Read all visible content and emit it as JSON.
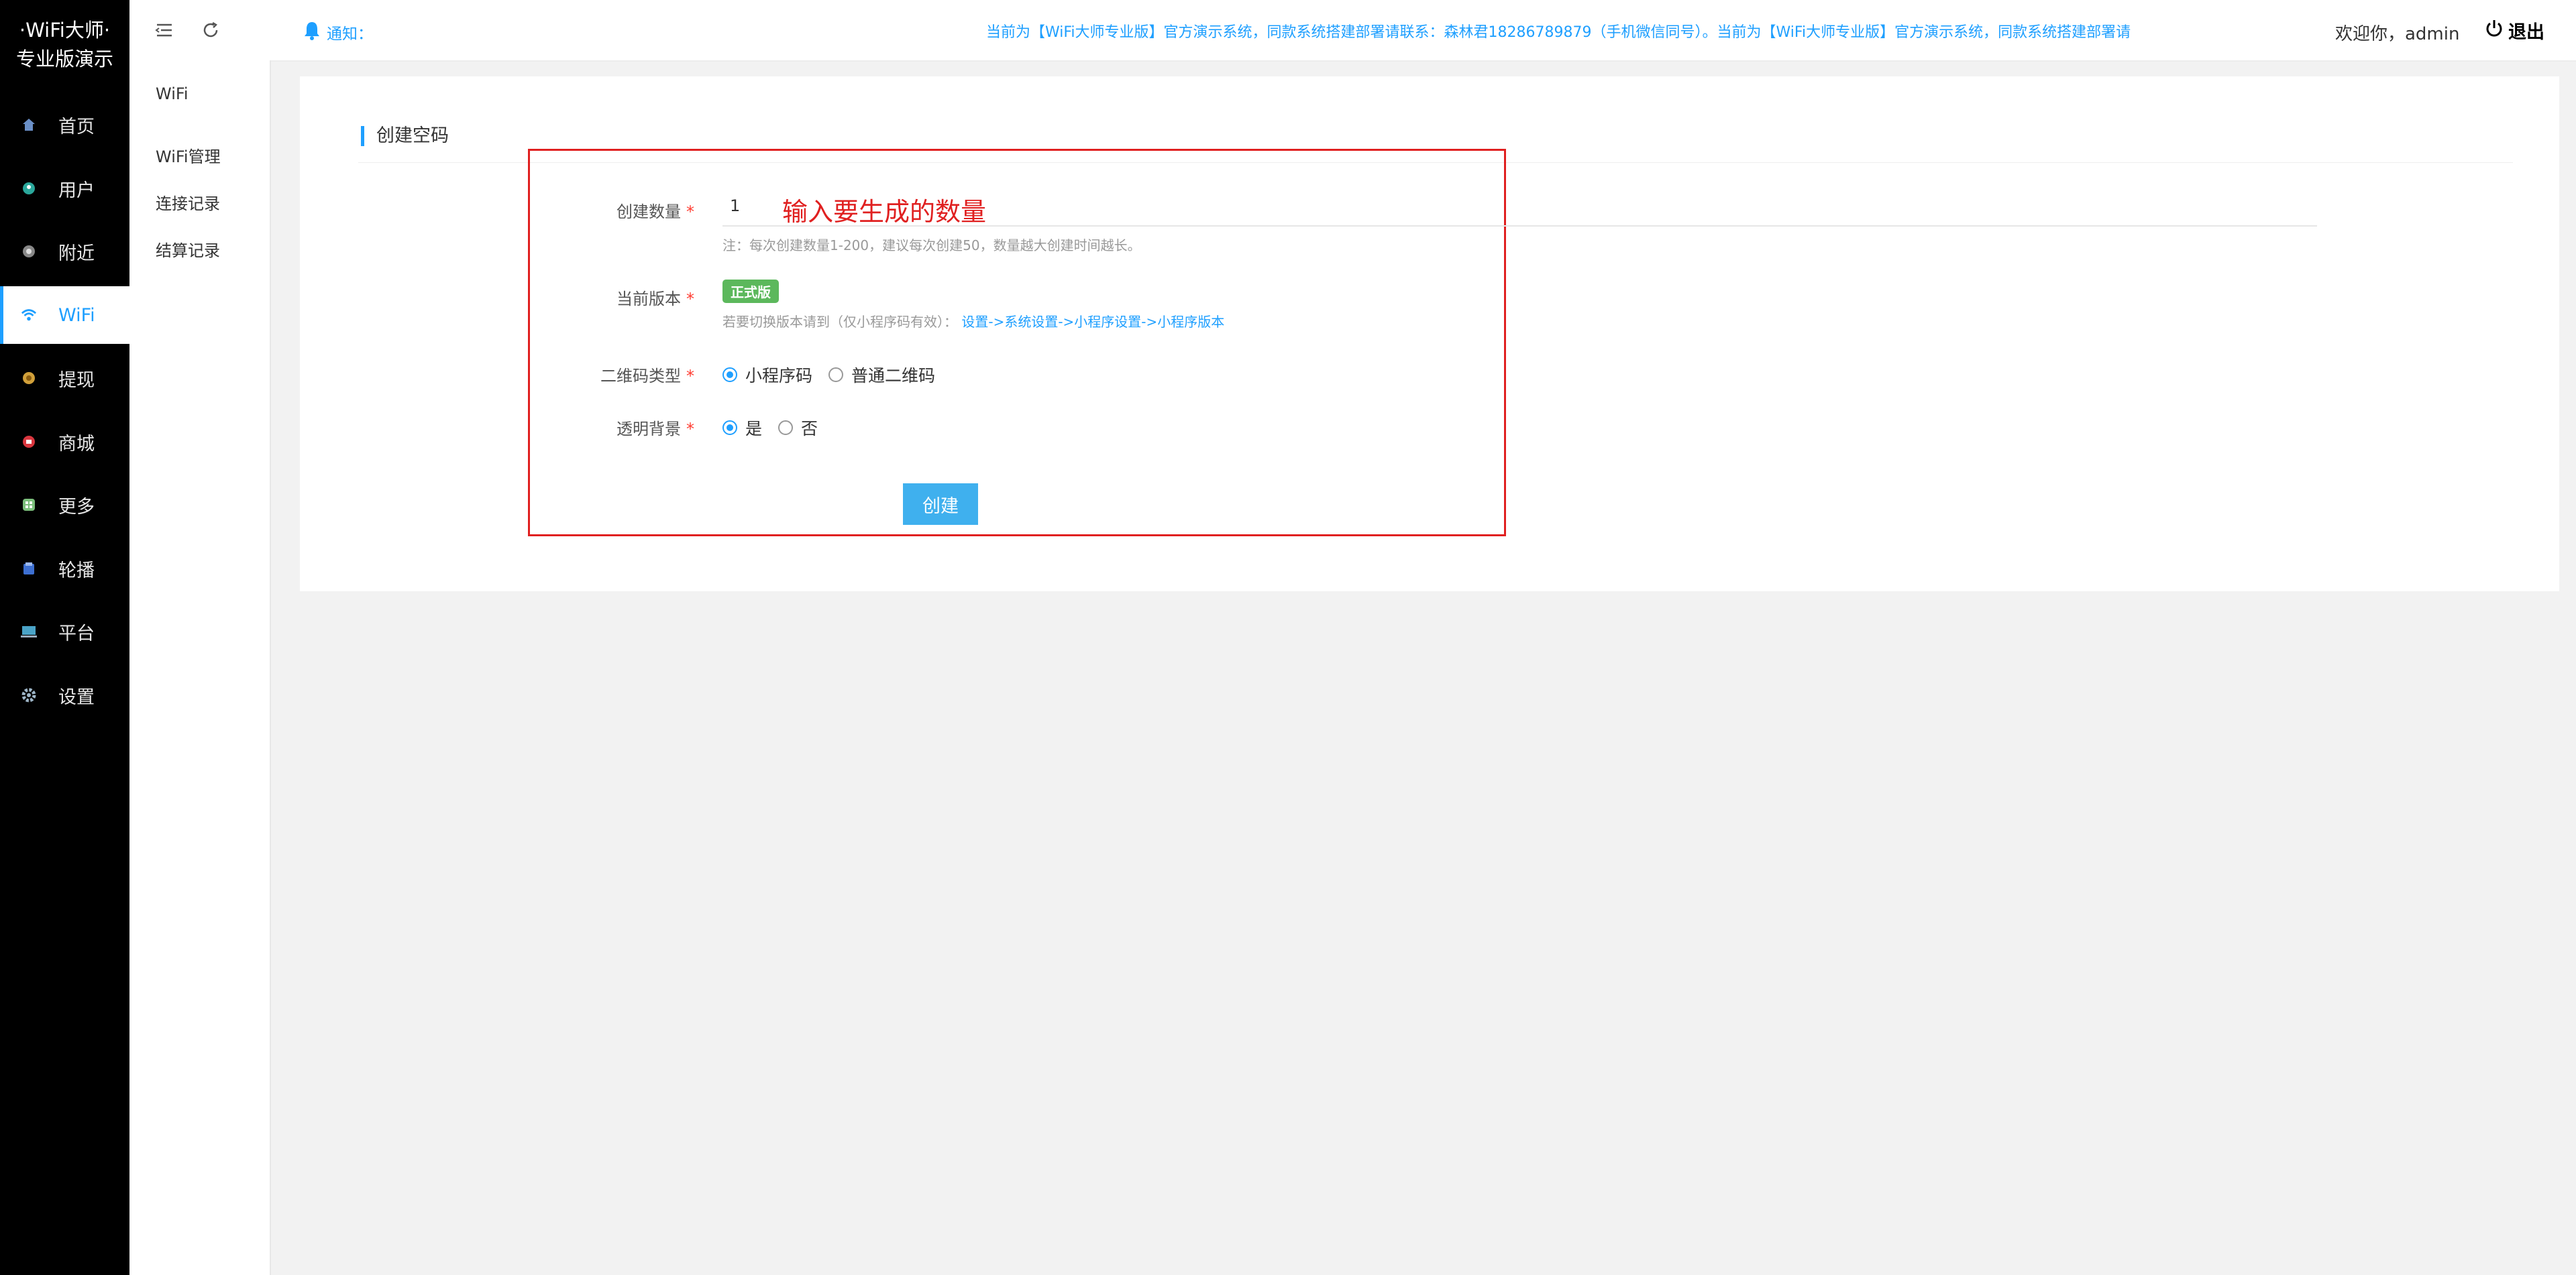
{
  "brand": {
    "line1": "·WiFi大师·",
    "line2": "专业版演示"
  },
  "sidebar": {
    "items": [
      {
        "label": "首页",
        "icon": "home-icon"
      },
      {
        "label": "用户",
        "icon": "user-icon"
      },
      {
        "label": "附近",
        "icon": "nearby-icon"
      },
      {
        "label": "WiFi",
        "icon": "wifi-icon",
        "active": true
      },
      {
        "label": "提现",
        "icon": "withdraw-icon"
      },
      {
        "label": "商城",
        "icon": "shop-icon"
      },
      {
        "label": "更多",
        "icon": "more-icon"
      },
      {
        "label": "轮播",
        "icon": "carousel-icon"
      },
      {
        "label": "平台",
        "icon": "platform-icon"
      },
      {
        "label": "设置",
        "icon": "gear-icon"
      }
    ]
  },
  "subnav": {
    "title": "WiFi",
    "links": [
      "WiFi管理",
      "连接记录",
      "结算记录"
    ]
  },
  "header": {
    "notice_label": "通知：",
    "marquee": "当前为【WiFi大师专业版】官方演示系统，同款系统搭建部署请联系：森林君18286789879（手机微信同号）。当前为【WiFi大师专业版】官方演示系统，同款系统搭建部署请",
    "welcome": "欢迎你，admin",
    "logout": "退出"
  },
  "card": {
    "title": "创建空码",
    "form": {
      "qty_label": "创建数量",
      "qty_value": "1",
      "qty_hint": "输入要生成的数量",
      "qty_note": "注：每次创建数量1-200，建议每次创建50，数量越大创建时间越长。",
      "version_label": "当前版本",
      "version_badge": "正式版",
      "version_help_prefix": "若要切换版本请到（仅小程序码有效）：",
      "version_help_link": "设置->系统设置->小程序设置->小程序版本",
      "qr_label": "二维码类型",
      "qr_options": [
        "小程序码",
        "普通二维码"
      ],
      "qr_selected": "小程序码",
      "bg_label": "透明背景",
      "bg_options": [
        "是",
        "否"
      ],
      "bg_selected": "是",
      "submit": "创建"
    }
  },
  "colors": {
    "accent": "#1e9fff",
    "sidebar_bg": "#000000",
    "highlight": "#e02020",
    "badge": "#5cb85c",
    "button": "#3fb0ee"
  }
}
